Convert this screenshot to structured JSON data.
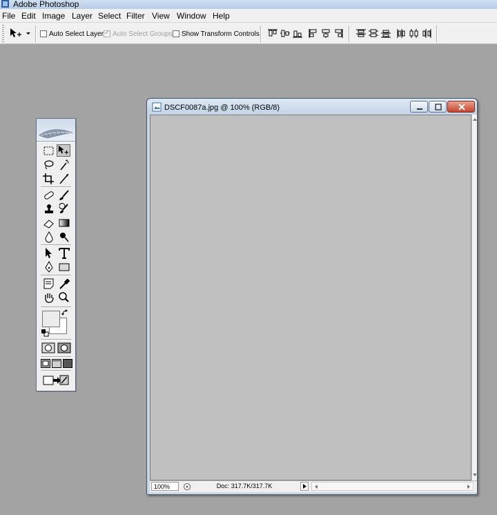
{
  "app": {
    "title": "Adobe Photoshop"
  },
  "menu": [
    "File",
    "Edit",
    "Image",
    "Layer",
    "Select",
    "Filter",
    "View",
    "Window",
    "Help"
  ],
  "options": {
    "auto_select_layer": "Auto Select Layer",
    "auto_select_groups": "Auto Select Groups",
    "show_transform_controls": "Show Transform Controls"
  },
  "document": {
    "title": "DSCF0087a.jpg @ 100% (RGB/8)",
    "zoom": "100%",
    "doc_info": "Doc: 317.7K/317.7K"
  },
  "tools": [
    "rectangular-marquee-tool",
    "move-tool",
    "lasso-tool",
    "magic-wand-tool",
    "crop-tool",
    "slice-tool",
    "healing-brush-tool",
    "brush-tool",
    "clone-stamp-tool",
    "history-brush-tool",
    "eraser-tool",
    "gradient-tool",
    "blur-tool",
    "dodge-tool",
    "path-selection-tool",
    "type-tool",
    "pen-tool",
    "shape-tool",
    "notes-tool",
    "eyedropper-tool",
    "hand-tool",
    "zoom-tool"
  ],
  "colors": {
    "foreground": "#ececec",
    "background": "#ffffff",
    "accent": "#c7432b"
  }
}
